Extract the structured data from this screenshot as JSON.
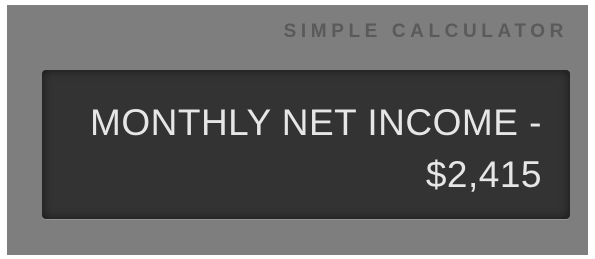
{
  "calculator": {
    "title": "SIMPLE CALCULATOR",
    "display": {
      "line1": "MONTHLY NET INCOME -",
      "line2": "$2,415"
    }
  },
  "colors": {
    "frame_bg": "#7e7e7e",
    "title_text": "#5a5a5a",
    "display_bg": "#333333",
    "display_text": "#e6e6e6"
  }
}
